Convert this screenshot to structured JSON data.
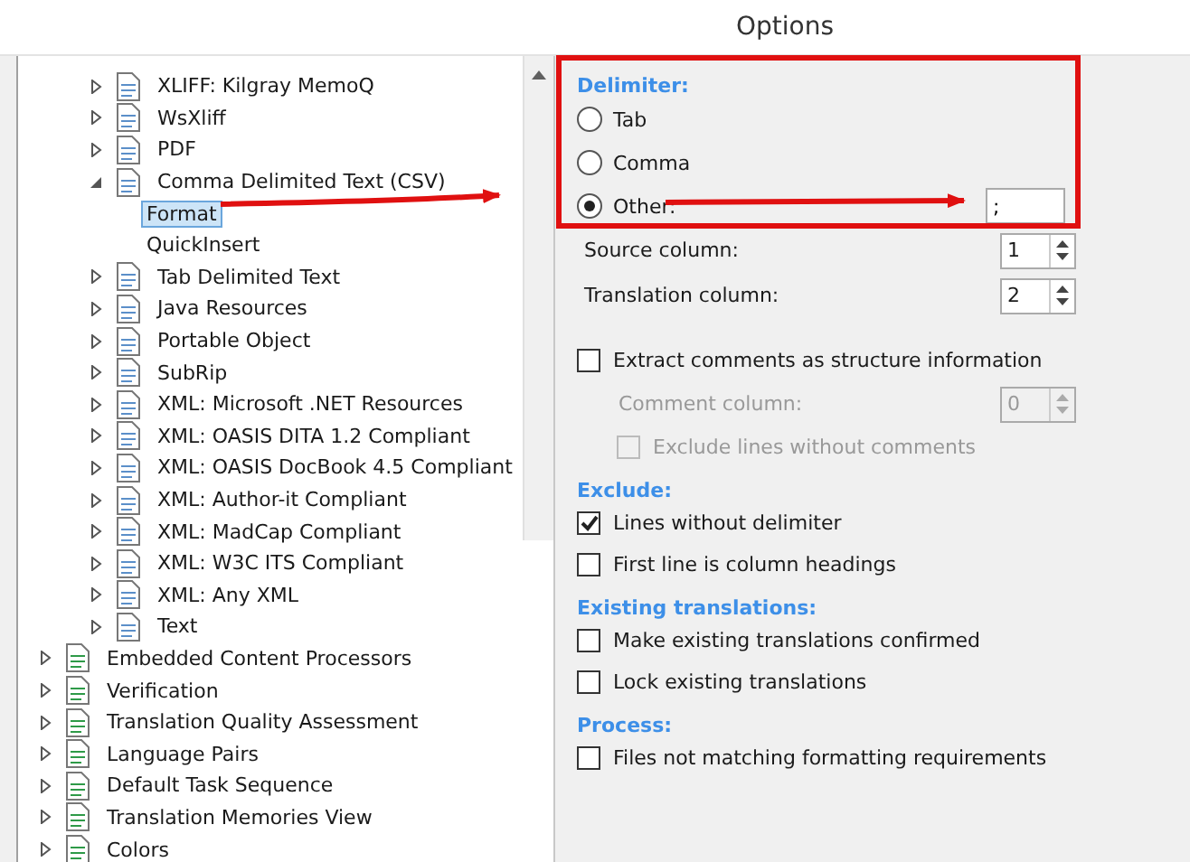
{
  "window": {
    "title": "Options"
  },
  "tree": {
    "continued_children": [
      {
        "label": "XLIFF: Kilgray MemoQ",
        "expanded": false,
        "selected": false
      },
      {
        "label": "WsXliff",
        "expanded": false,
        "selected": false
      },
      {
        "label": "PDF",
        "expanded": false,
        "selected": false
      },
      {
        "label": "Comma Delimited Text (CSV)",
        "expanded": true,
        "selected": false,
        "children": [
          {
            "label": "Format",
            "selected": true
          },
          {
            "label": "QuickInsert",
            "selected": false
          }
        ]
      },
      {
        "label": "Tab Delimited Text",
        "expanded": false,
        "selected": false
      },
      {
        "label": "Java Resources",
        "expanded": false,
        "selected": false
      },
      {
        "label": "Portable Object",
        "expanded": false,
        "selected": false
      },
      {
        "label": "SubRip",
        "expanded": false,
        "selected": false
      },
      {
        "label": "XML: Microsoft .NET Resources",
        "expanded": false,
        "selected": false
      },
      {
        "label": "XML: OASIS DITA 1.2 Compliant",
        "expanded": false,
        "selected": false
      },
      {
        "label": "XML: OASIS DocBook 4.5 Compliant",
        "expanded": false,
        "selected": false
      },
      {
        "label": "XML: Author-it Compliant",
        "expanded": false,
        "selected": false
      },
      {
        "label": "XML: MadCap Compliant",
        "expanded": false,
        "selected": false
      },
      {
        "label": "XML: W3C ITS Compliant",
        "expanded": false,
        "selected": false
      },
      {
        "label": "XML: Any XML",
        "expanded": false,
        "selected": false
      },
      {
        "label": "Text",
        "expanded": false,
        "selected": false
      }
    ],
    "items": [
      {
        "label": "Embedded Content Processors",
        "expanded": false,
        "selected": false
      },
      {
        "label": "Verification",
        "expanded": false,
        "selected": false
      },
      {
        "label": "Translation Quality Assessment",
        "expanded": false,
        "selected": false
      },
      {
        "label": "Language Pairs",
        "expanded": false,
        "selected": false
      },
      {
        "label": "Default Task Sequence",
        "expanded": false,
        "selected": false
      },
      {
        "label": "Translation Memories View",
        "expanded": false,
        "selected": false
      },
      {
        "label": "Colors",
        "expanded": false,
        "selected": false
      }
    ]
  },
  "delimiter": {
    "heading": "Delimiter:",
    "options": [
      {
        "label": "Tab",
        "selected": false
      },
      {
        "label": "Comma",
        "selected": false
      },
      {
        "label": "Other:",
        "selected": true
      }
    ],
    "other_value": ";"
  },
  "columns": [
    {
      "label": "Source column:",
      "value": "1",
      "disabled": false
    },
    {
      "label": "Translation column:",
      "value": "2",
      "disabled": false
    }
  ],
  "comments": {
    "extract": {
      "label": "Extract comments as structure information",
      "checked": false,
      "disabled": false
    },
    "column": {
      "label": "Comment column:",
      "value": "0",
      "disabled": true
    },
    "exclude": {
      "label": "Exclude lines without comments",
      "checked": false,
      "disabled": true
    }
  },
  "sections": [
    {
      "heading": "Exclude:",
      "options": [
        {
          "label": "Lines without delimiter",
          "checked": true,
          "disabled": false
        },
        {
          "label": "First line is column headings",
          "checked": false,
          "disabled": false
        }
      ]
    },
    {
      "heading": "Existing translations:",
      "options": [
        {
          "label": "Make existing translations confirmed",
          "checked": false,
          "disabled": false
        },
        {
          "label": "Lock existing translations",
          "checked": false,
          "disabled": false
        }
      ]
    },
    {
      "heading": "Process:",
      "options": [
        {
          "label": "Files not matching formatting requirements",
          "checked": false,
          "disabled": false
        }
      ]
    }
  ]
}
